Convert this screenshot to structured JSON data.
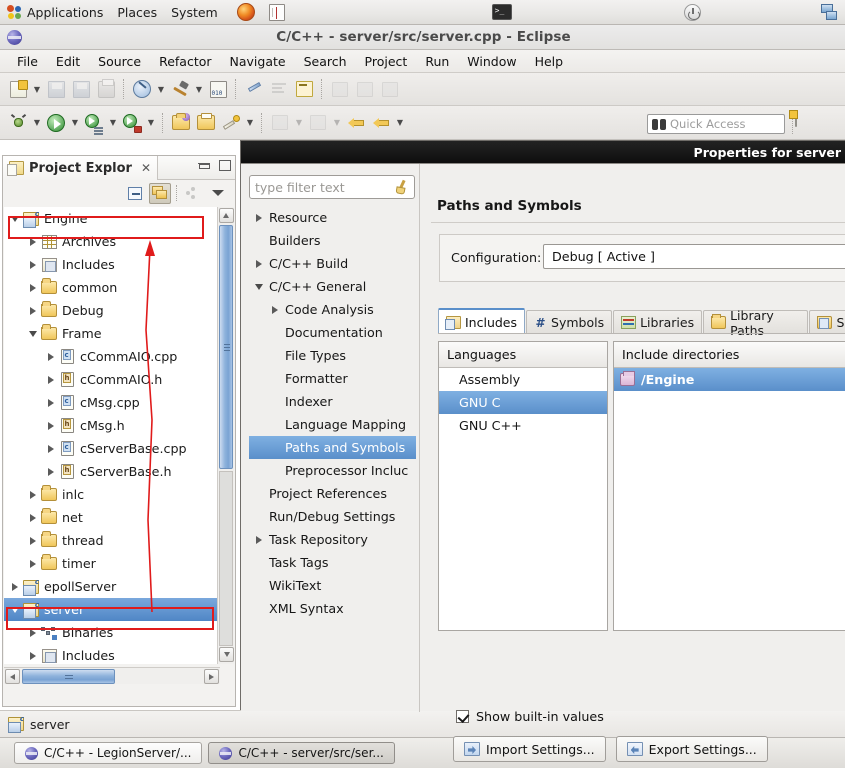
{
  "desktop": {
    "panel": {
      "menus": [
        "Applications",
        "Places",
        "System"
      ],
      "launchers": [
        "firefox-icon",
        "help-book-icon",
        "terminal-icon",
        "shutdown-icon",
        "network-monitor-icon"
      ]
    },
    "taskbar": {
      "items": [
        {
          "label": "C/C++ - LegionServer/...",
          "active": false
        },
        {
          "label": "C/C++ - server/src/ser...",
          "active": true
        }
      ]
    }
  },
  "window": {
    "title": "C/C++ - server/src/server.cpp - Eclipse",
    "menubar": [
      "File",
      "Edit",
      "Source",
      "Refactor",
      "Navigate",
      "Search",
      "Project",
      "Run",
      "Window",
      "Help"
    ],
    "quick_access": {
      "placeholder": "Quick Access",
      "icon": "binoculars-icon"
    }
  },
  "project_explorer": {
    "tab_label": "Project Explor",
    "close_glyph": "✕",
    "toolbar": [
      "collapse-all-icon",
      "link-with-editor-icon",
      "focus-icon",
      "view-menu-icon"
    ],
    "tree": [
      {
        "label": "Engine",
        "indent": 0,
        "twisty": "down",
        "icon": "cproject-icon",
        "selected": false,
        "annotated": true
      },
      {
        "label": "Archives",
        "indent": 1,
        "twisty": "right",
        "icon": "archives-icon",
        "selected": false
      },
      {
        "label": "Includes",
        "indent": 1,
        "twisty": "right",
        "icon": "includes-icon",
        "selected": false
      },
      {
        "label": "common",
        "indent": 1,
        "twisty": "right",
        "icon": "folder-icon",
        "selected": false
      },
      {
        "label": "Debug",
        "indent": 1,
        "twisty": "right",
        "icon": "folder-icon",
        "selected": false
      },
      {
        "label": "Frame",
        "indent": 1,
        "twisty": "down",
        "icon": "folder-icon",
        "selected": false
      },
      {
        "label": "cCommAIO.cpp",
        "indent": 2,
        "twisty": "right",
        "icon": "cpp-file-icon",
        "selected": false
      },
      {
        "label": "cCommAIO.h",
        "indent": 2,
        "twisty": "right",
        "icon": "h-file-icon",
        "selected": false
      },
      {
        "label": "cMsg.cpp",
        "indent": 2,
        "twisty": "right",
        "icon": "cpp-file-icon",
        "selected": false
      },
      {
        "label": "cMsg.h",
        "indent": 2,
        "twisty": "right",
        "icon": "h-file-icon",
        "selected": false
      },
      {
        "label": "cServerBase.cpp",
        "indent": 2,
        "twisty": "right",
        "icon": "cpp-file-icon",
        "selected": false
      },
      {
        "label": "cServerBase.h",
        "indent": 2,
        "twisty": "right",
        "icon": "h-file-icon",
        "selected": false
      },
      {
        "label": "inlc",
        "indent": 1,
        "twisty": "right",
        "icon": "folder-icon",
        "selected": false
      },
      {
        "label": "net",
        "indent": 1,
        "twisty": "right",
        "icon": "folder-icon",
        "selected": false
      },
      {
        "label": "thread",
        "indent": 1,
        "twisty": "right",
        "icon": "folder-icon",
        "selected": false
      },
      {
        "label": "timer",
        "indent": 1,
        "twisty": "right",
        "icon": "folder-icon",
        "selected": false
      },
      {
        "label": "epollServer",
        "indent": 0,
        "twisty": "right",
        "icon": "cproject-icon",
        "selected": false
      },
      {
        "label": "server",
        "indent": 0,
        "twisty": "down",
        "icon": "cproject-icon",
        "selected": true,
        "annotated": true
      },
      {
        "label": "Binaries",
        "indent": 1,
        "twisty": "right",
        "icon": "binaries-icon",
        "selected": false
      },
      {
        "label": "Includes",
        "indent": 1,
        "twisty": "right",
        "icon": "includes-icon",
        "selected": false
      }
    ]
  },
  "statusbar": {
    "selection_label": "server",
    "selection_icon": "cproject-icon"
  },
  "dialog": {
    "title": "Properties for server",
    "filter": {
      "placeholder": "type filter text",
      "icon": "broom-icon"
    },
    "tree": [
      {
        "label": "Resource",
        "indent": 0,
        "twisty": "right",
        "selected": false
      },
      {
        "label": "Builders",
        "indent": 0,
        "twisty": "none",
        "selected": false
      },
      {
        "label": "C/C++ Build",
        "indent": 0,
        "twisty": "right",
        "selected": false
      },
      {
        "label": "C/C++ General",
        "indent": 0,
        "twisty": "down",
        "selected": false
      },
      {
        "label": "Code Analysis",
        "indent": 1,
        "twisty": "right",
        "selected": false
      },
      {
        "label": "Documentation",
        "indent": 1,
        "twisty": "none",
        "selected": false
      },
      {
        "label": "File Types",
        "indent": 1,
        "twisty": "none",
        "selected": false
      },
      {
        "label": "Formatter",
        "indent": 1,
        "twisty": "none",
        "selected": false
      },
      {
        "label": "Indexer",
        "indent": 1,
        "twisty": "none",
        "selected": false
      },
      {
        "label": "Language Mapping",
        "indent": 1,
        "twisty": "none",
        "selected": false
      },
      {
        "label": "Paths and Symbols",
        "indent": 1,
        "twisty": "none",
        "selected": true
      },
      {
        "label": "Preprocessor Incluc",
        "indent": 1,
        "twisty": "none",
        "selected": false
      },
      {
        "label": "Project References",
        "indent": 0,
        "twisty": "none",
        "selected": false
      },
      {
        "label": "Run/Debug Settings",
        "indent": 0,
        "twisty": "none",
        "selected": false
      },
      {
        "label": "Task Repository",
        "indent": 0,
        "twisty": "right",
        "selected": false
      },
      {
        "label": "Task Tags",
        "indent": 0,
        "twisty": "none",
        "selected": false
      },
      {
        "label": "WikiText",
        "indent": 0,
        "twisty": "none",
        "selected": false
      },
      {
        "label": "XML Syntax",
        "indent": 0,
        "twisty": "none",
        "selected": false
      }
    ],
    "pane": {
      "title": "Paths and Symbols",
      "configuration_label": "Configuration:",
      "configuration_value": "Debug  [ Active ]",
      "tabs": [
        {
          "label": "Includes",
          "icon": "includes-tab-icon",
          "active": true
        },
        {
          "label": "Symbols",
          "icon": "hash-icon",
          "active": false
        },
        {
          "label": "Libraries",
          "icon": "libraries-icon",
          "active": false
        },
        {
          "label": "Library Paths",
          "icon": "library-paths-icon",
          "active": false
        },
        {
          "label": "Sou",
          "icon": "source-location-icon",
          "active": false
        }
      ],
      "languages": {
        "header": "Languages",
        "items": [
          {
            "label": "Assembly",
            "selected": false
          },
          {
            "label": "GNU C",
            "selected": true
          },
          {
            "label": "GNU C++",
            "selected": false
          }
        ]
      },
      "include_directories": {
        "header": "Include directories",
        "items": [
          {
            "label": "/Engine",
            "icon": "include-dir-icon",
            "selected": true
          }
        ]
      },
      "show_builtin": {
        "label": "Show built-in values",
        "checked": true
      },
      "buttons": [
        {
          "label": "Import Settings...",
          "icon": "import-icon"
        },
        {
          "label": "Export Settings...",
          "icon": "export-icon"
        }
      ]
    }
  },
  "annotations": {
    "color": "#e01b1b"
  }
}
